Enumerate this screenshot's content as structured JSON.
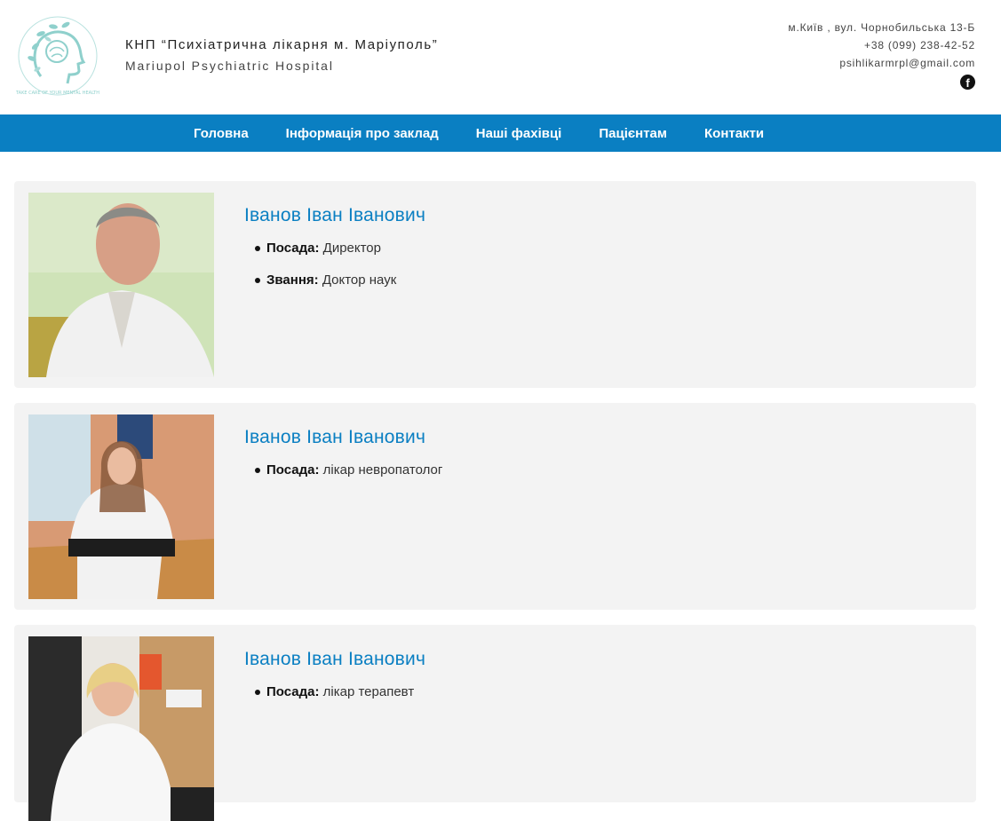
{
  "header": {
    "title_ua": "КНП “Психіатрична лікарня м. Маріуполь”",
    "title_en": "Mariupol Psychiatric Hospital",
    "address": "м.Київ , вул. Чорнобильська 13-Б",
    "phone": "+38 (099) 238-42-52",
    "email": "psihlikarmrpl@gmail.com",
    "logo_text": "TAKE CARE OF YOUR MENTAL HEALTH",
    "facebook_icon": "f"
  },
  "nav": {
    "items": [
      {
        "label": "Головна"
      },
      {
        "label": "Інформація про заклад"
      },
      {
        "label": "Наші фахівці"
      },
      {
        "label": "Пацієнтам"
      },
      {
        "label": "Контакти"
      }
    ]
  },
  "staff": [
    {
      "name": "Іванов Іван Іванович",
      "position_label": "Посада:",
      "position": "Директор",
      "rank_label": "Звання:",
      "rank": "Доктор наук"
    },
    {
      "name": "Іванов Іван Іванович",
      "position_label": "Посада:",
      "position": "лікар невропатолог"
    },
    {
      "name": "Іванов Іван Іванович",
      "position_label": "Посада:",
      "position": "лікар терапевт"
    }
  ],
  "colors": {
    "accent": "#0a7fc2",
    "card_bg": "#f3f3f3",
    "logo_teal": "#8fd0cc"
  }
}
